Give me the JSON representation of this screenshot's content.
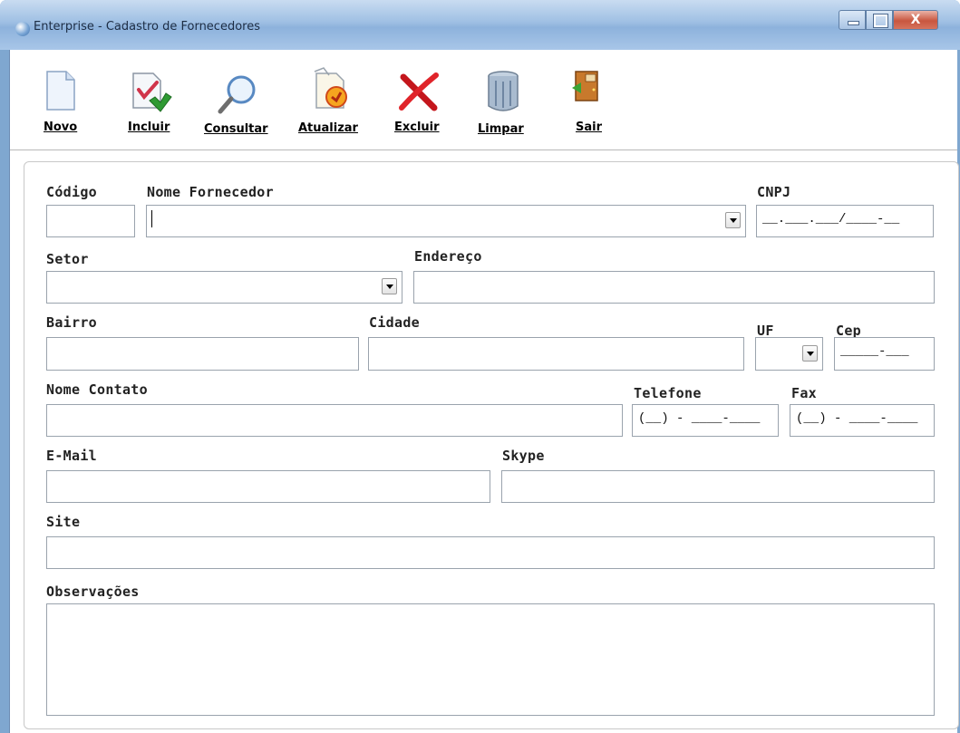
{
  "window": {
    "title": "Enterprise - Cadastro de Fornecedores",
    "close_glyph": "X"
  },
  "toolbar": {
    "buttons": [
      {
        "label": "Novo",
        "icon": "new-document-icon"
      },
      {
        "label": "Incluir",
        "icon": "include-icon"
      },
      {
        "label": "Consultar",
        "icon": "search-icon"
      },
      {
        "label": "Atualizar",
        "icon": "update-icon"
      },
      {
        "label": "Excluir",
        "icon": "delete-icon"
      },
      {
        "label": "Limpar",
        "icon": "trash-can-icon"
      },
      {
        "label": "Sair",
        "icon": "exit-door-icon"
      }
    ]
  },
  "form": {
    "codigo": {
      "label": "Código",
      "value": ""
    },
    "nome_fornecedor": {
      "label": "Nome Fornecedor",
      "value": ""
    },
    "cnpj": {
      "label": "CNPJ",
      "mask": "__.___.___/____-__"
    },
    "setor": {
      "label": "Setor",
      "value": ""
    },
    "endereco": {
      "label": "Endereço",
      "value": ""
    },
    "bairro": {
      "label": "Bairro",
      "value": ""
    },
    "cidade": {
      "label": "Cidade",
      "value": ""
    },
    "uf": {
      "label": "UF",
      "value": ""
    },
    "cep": {
      "label": "Cep",
      "mask": "_____-___"
    },
    "nome_contato": {
      "label": "Nome Contato",
      "value": ""
    },
    "telefone": {
      "label": "Telefone",
      "mask": "(__) - ____-____"
    },
    "fax": {
      "label": "Fax",
      "mask": "(__) - ____-____"
    },
    "email": {
      "label": "E-Mail",
      "value": ""
    },
    "skype": {
      "label": "Skype",
      "value": ""
    },
    "site": {
      "label": "Site",
      "value": ""
    },
    "observacoes": {
      "label": "Observações",
      "value": ""
    }
  }
}
